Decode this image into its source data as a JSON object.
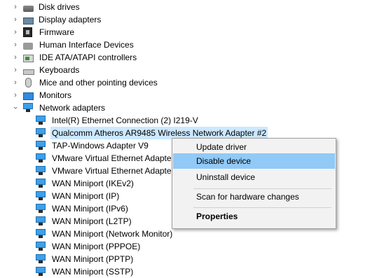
{
  "tree": {
    "categories": [
      {
        "label": "Disk drives",
        "icon": "disk-drive-icon"
      },
      {
        "label": "Display adapters",
        "icon": "display-adapter-icon"
      },
      {
        "label": "Firmware",
        "icon": "firmware-icon"
      },
      {
        "label": "Human Interface Devices",
        "icon": "hid-icon"
      },
      {
        "label": "IDE ATA/ATAPI controllers",
        "icon": "ide-controller-icon"
      },
      {
        "label": "Keyboards",
        "icon": "keyboard-icon"
      },
      {
        "label": "Mice and other pointing devices",
        "icon": "mouse-icon"
      },
      {
        "label": "Monitors",
        "icon": "monitor-icon"
      }
    ],
    "network_adapters": {
      "label": "Network adapters",
      "icon": "network-adapter-icon",
      "expanded": true,
      "children": [
        "Intel(R) Ethernet Connection (2) I219-V",
        "Qualcomm Atheros AR9485 Wireless Network Adapter #2",
        "TAP-Windows Adapter V9",
        "VMware Virtual Ethernet Adapter",
        "VMware Virtual Ethernet Adapter",
        "WAN Miniport (IKEv2)",
        "WAN Miniport (IP)",
        "WAN Miniport (IPv6)",
        "WAN Miniport (L2TP)",
        "WAN Miniport (Network Monitor)",
        "WAN Miniport (PPPOE)",
        "WAN Miniport (PPTP)",
        "WAN Miniport (SSTP)"
      ],
      "selected_index": 1
    }
  },
  "context_menu": {
    "update_driver": "Update driver",
    "disable_device": "Disable device",
    "uninstall_device": "Uninstall device",
    "scan_hardware": "Scan for hardware changes",
    "properties": "Properties",
    "highlighted": "Disable device"
  },
  "colors": {
    "selection": "#cce8ff",
    "menu_highlight": "#91c9f7",
    "network_icon": "#3fa0e8"
  }
}
